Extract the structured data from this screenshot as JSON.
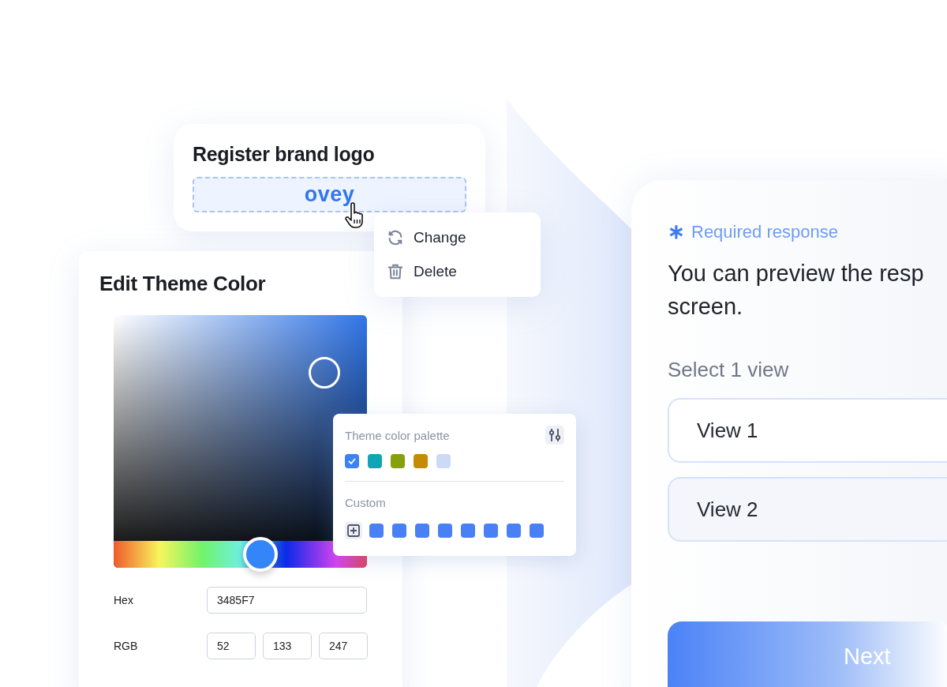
{
  "logo_card": {
    "title": "Register brand logo",
    "logo": "ovey"
  },
  "logo_menu": [
    {
      "label": "Change",
      "kind": "change"
    },
    {
      "label": "Delete",
      "kind": "delete"
    }
  ],
  "theme_editor": {
    "title": "Edit Theme Color",
    "hue": {
      "level": 0.58
    },
    "hex": {
      "label": "Hex",
      "value": "3485F7"
    },
    "rgb": {
      "label": "RGB",
      "values": [
        "52",
        "133",
        "247"
      ]
    }
  },
  "palette": {
    "title": "Theme color palette",
    "swatches": [
      {
        "color": "#3b82f6",
        "selected": true
      },
      {
        "color": "#0ea5b5",
        "selected": false
      },
      {
        "color": "#86a00c",
        "selected": false
      },
      {
        "color": "#c58b05",
        "selected": false
      },
      {
        "color": "#ccdaf5",
        "selected": false
      }
    ],
    "custom_title": "Custom",
    "custom_swatches": [
      {
        "color": "#4a80f5"
      },
      {
        "color": "#4a80f5"
      },
      {
        "color": "#4a80f5"
      },
      {
        "color": "#4a80f5"
      },
      {
        "color": "#4a80f5"
      },
      {
        "color": "#4a80f5"
      },
      {
        "color": "#4a80f5"
      },
      {
        "color": "#4a80f5"
      }
    ]
  },
  "preview": {
    "required_mark": "∗",
    "required": "Required response",
    "question_lines": [
      "You can preview the resp",
      "screen."
    ],
    "select_label": "Select 1 view",
    "options": [
      {
        "label": "View 1"
      },
      {
        "label": "View 2"
      }
    ],
    "next_button": "Next"
  }
}
